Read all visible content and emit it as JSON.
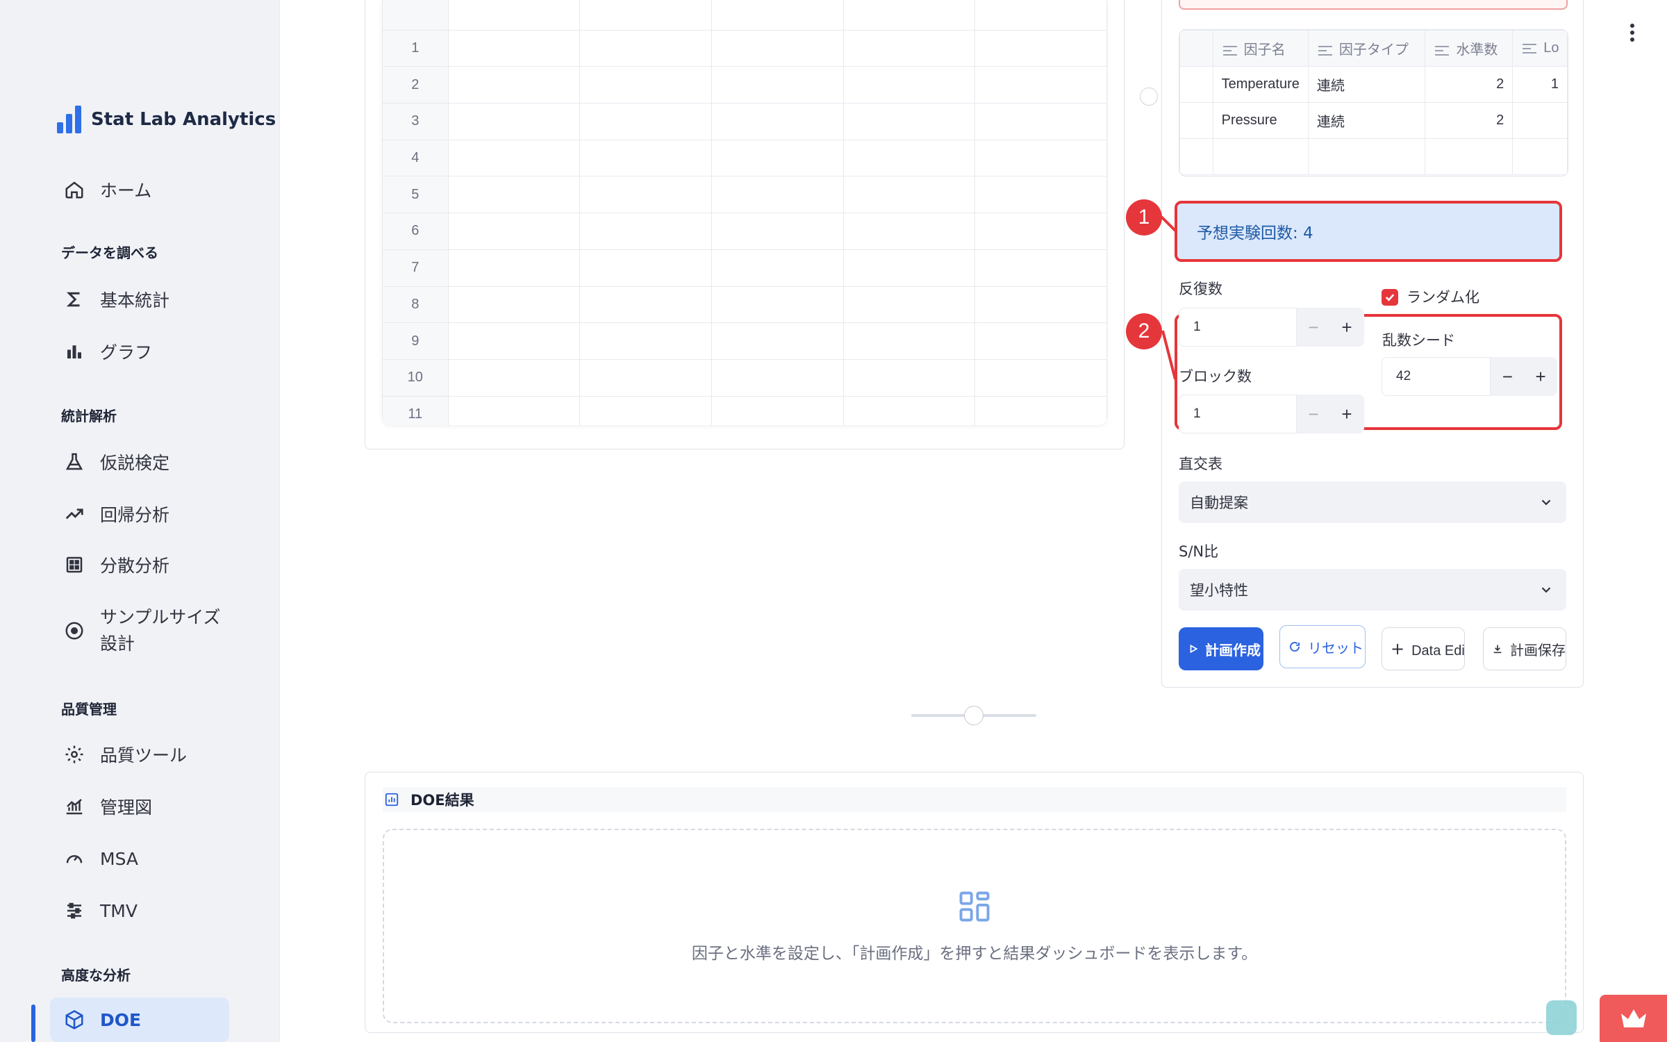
{
  "app": {
    "title": "Stat Lab Analytics"
  },
  "sidebar": {
    "home": "ホーム",
    "sections": {
      "explore": "データを調べる",
      "stats": "統計解析",
      "quality": "品質管理",
      "advanced": "高度な分析"
    },
    "items": {
      "basic_stats": "基本統計",
      "graph": "グラフ",
      "hypothesis": "仮説検定",
      "regression": "回帰分析",
      "anova": "分散分析",
      "sample_size_1": "サンプルサイズ",
      "sample_size_2": "設計",
      "quality_tools": "品質ツール",
      "control_chart": "管理図",
      "msa": "MSA",
      "tmv": "TMV",
      "doe": "DOE"
    }
  },
  "grid": {
    "rows": [
      "1",
      "2",
      "3",
      "4",
      "5",
      "6",
      "7",
      "8",
      "9",
      "10",
      "11"
    ]
  },
  "factors": {
    "headers": [
      "因子名",
      "因子タイプ",
      "水準数",
      "Lo"
    ],
    "rows": [
      {
        "name": "Temperature",
        "type": "連続",
        "levels": "2",
        "low": "1"
      },
      {
        "name": "Pressure",
        "type": "連続",
        "levels": "2",
        "low": ""
      }
    ]
  },
  "annotations": {
    "badge1": "1",
    "badge2": "2"
  },
  "expected_runs": "予想実験回数: 4",
  "settings": {
    "replicates_label": "反復数",
    "replicates_value": "1",
    "randomize_label": "ランダム化",
    "seed_label": "乱数シード",
    "seed_value": "42",
    "blocks_label": "ブロック数",
    "blocks_value": "1",
    "minus": "−",
    "plus": "+",
    "orthogonal_label": "直交表",
    "orthogonal_value": "自動提案",
    "sn_label": "S/N比",
    "sn_value": "望小特性"
  },
  "buttons": {
    "create": "計画作成",
    "reset": "リセット",
    "data_editor": "Data Editorへ",
    "save": "計画保存"
  },
  "results": {
    "title": "DOE結果",
    "empty": "因子と水準を設定し、「計画作成」を押すと結果ダッシュボードを表示します。"
  },
  "colors": {
    "accent": "#2a62e0",
    "annotation": "#e5363b",
    "info_bg": "#dbe8fb"
  }
}
